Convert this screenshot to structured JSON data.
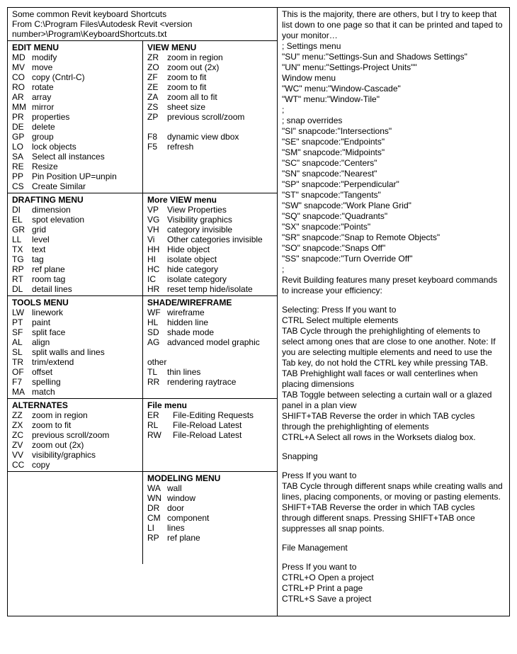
{
  "top_note": {
    "l1": "Some common Revit keyboard Shortcuts",
    "l2": "From  C:\\Program Files\\Autodesk Revit <version number>\\Program\\KeyboardShortcuts.txt"
  },
  "right_intro": "This is the majority, there are others, but I try to keep that list down to one page so that it can be printed and taped to your monitor…",
  "settings_menu_title": "; Settings menu",
  "settings_menu": [
    "\"SU\"  menu:\"Settings-Sun and Shadows Settings\"",
    "\"UN\"  menu:\"Settings-Project Units\"\""
  ],
  "window_menu_title": "Window menu",
  "window_menu": [
    "\"WC\"  menu:\"Window-Cascade\"",
    "\"WT\"  menu:\"Window-Tile\""
  ],
  "snap_title": "; snap overrides",
  "snap_overrides": [
    "\"SI\"    snapcode:\"Intersections\"",
    "\"SE\"   snapcode:\"Endpoints\"",
    "\"SM\"  snapcode:\"Midpoints\"",
    "\"SC\"  snapcode:\"Centers\"",
    "\"SN\"  snapcode:\"Nearest\"",
    "\"SP\"  snapcode:\"Perpendicular\"",
    "\"ST\"   snapcode:\"Tangents\"",
    "\"SW\"  snapcode:\"Work Plane Grid\"",
    "\"SQ\"  snapcode:\"Quadrants\"",
    "\"SX\"   snapcode:\"Points\"",
    "\"SR\"  snapcode:\"Snap to Remote Objects\"",
    "\"SO\"  snapcode:\"Snaps Off\"",
    "\"SS\"  snapcode:\"Turn Override Off\""
  ],
  "tips_intro": "Revit Building features many preset keyboard commands to increase your efficiency:",
  "selecting_title": "Selecting: Press If you want to",
  "selecting": [
    "CTRL Select multiple elements",
    "TAB Cycle through the prehighlighting of elements to select among ones that are close to one another. Note: If you are selecting multiple elements and need to use the Tab key, do not hold the CTRL key while pressing TAB.",
    "TAB Prehighlight wall faces or wall centerlines when placing dimensions",
    "TAB Toggle between selecting a curtain wall or a glazed panel in a plan view",
    "SHIFT+TAB Reverse the order in which TAB cycles through the prehighlighting of elements",
    "CTRL+A Select all rows in the Worksets dialog box."
  ],
  "snapping_title": "Snapping",
  "snapping_press": "Press If you want to",
  "snapping": [
    "TAB Cycle through different snaps while creating walls and lines, placing components, or moving or pasting elements.",
    "SHIFT+TAB Reverse the order in which TAB cycles through different snaps. Pressing SHIFT+TAB once suppresses all snap points."
  ],
  "file_title": "File Management",
  "file_press": "Press If you want to",
  "file_ops": [
    "CTRL+O Open a project",
    "CTRL+P Print a page",
    "CTRL+S Save a project"
  ],
  "menus": {
    "edit": {
      "title": "EDIT MENU",
      "items": [
        {
          "c": "MD",
          "t": "modify"
        },
        {
          "c": "MV",
          "t": "move"
        },
        {
          "c": "CO",
          "t": "copy (Cntrl-C)"
        },
        {
          "c": "RO",
          "t": "rotate"
        },
        {
          "c": "AR",
          "t": "array"
        },
        {
          "c": "MM",
          "t": "mirror"
        },
        {
          "c": "PR",
          "t": "properties"
        },
        {
          "c": "DE",
          "t": "delete"
        },
        {
          "c": "GP",
          "t": "group"
        },
        {
          "c": "LO",
          "t": "lock objects"
        },
        {
          "c": "SA",
          "t": "Select all instances"
        },
        {
          "c": "RE",
          "t": "Resize"
        },
        {
          "c": "PP",
          "t": "Pin Position UP=unpin"
        },
        {
          "c": "CS",
          "t": "Create Similar"
        }
      ]
    },
    "view": {
      "title": "VIEW MENU",
      "items": [
        {
          "c": "ZR",
          "t": "zoom in region"
        },
        {
          "c": "ZO",
          "t": "zoom out (2x)"
        },
        {
          "c": "ZF",
          "t": "zoom to fit"
        },
        {
          "c": "ZE",
          "t": "zoom to fit"
        },
        {
          "c": "ZA",
          "t": "zoom all to fit"
        },
        {
          "c": "ZS",
          "t": "sheet size"
        },
        {
          "c": "ZP",
          "t": "previous scroll/zoom"
        },
        {
          "c": "",
          "t": ""
        },
        {
          "c": "F8",
          "t": "dynamic view dbox"
        },
        {
          "c": "F5",
          "t": "refresh"
        }
      ]
    },
    "drafting": {
      "title": "DRAFTING MENU",
      "items": [
        {
          "c": "DI",
          "t": "dimension"
        },
        {
          "c": "EL",
          "t": "spot elevation"
        },
        {
          "c": "GR",
          "t": "grid"
        },
        {
          "c": "LL",
          "t": "level"
        },
        {
          "c": "TX",
          "t": "text"
        },
        {
          "c": "TG",
          "t": "tag"
        },
        {
          "c": "RP",
          "t": "ref plane"
        },
        {
          "c": "RT",
          "t": "room tag"
        },
        {
          "c": "DL",
          "t": "detail lines"
        }
      ]
    },
    "moreview": {
      "title": "More VIEW menu",
      "items": [
        {
          "c": "VP",
          "t": "View Properties"
        },
        {
          "c": "VG",
          "t": "Visibility graphics"
        },
        {
          "c": "VH",
          "t": "category invisible"
        },
        {
          "c": "Vi",
          "t": "Other categories invisible"
        },
        {
          "c": "HH",
          "t": "Hide object"
        },
        {
          "c": "HI",
          "t": "isolate object"
        },
        {
          "c": "HC",
          "t": "hide category"
        },
        {
          "c": "IC",
          "t": "isolate category"
        },
        {
          "c": "HR",
          "t": "reset temp hide/isolate"
        }
      ]
    },
    "tools": {
      "title": "TOOLS MENU",
      "items": [
        {
          "c": "LW",
          "t": "linework"
        },
        {
          "c": "PT",
          "t": "paint"
        },
        {
          "c": "SF",
          "t": "split face"
        },
        {
          "c": "AL",
          "t": "align"
        },
        {
          "c": "SL",
          "t": "split walls and lines"
        },
        {
          "c": "TR",
          "t": "trim/extend"
        },
        {
          "c": "OF",
          "t": "offset"
        },
        {
          "c": "F7",
          "t": "spelling"
        },
        {
          "c": "MA",
          "t": "match"
        }
      ]
    },
    "shade": {
      "title": "SHADE/WIREFRAME",
      "items": [
        {
          "c": "WF",
          "t": "wireframe"
        },
        {
          "c": "HL",
          "t": "hidden line"
        },
        {
          "c": "SD",
          "t": "shade mode"
        },
        {
          "c": "AG",
          "t": "advanced model graphic"
        },
        {
          "c": "",
          "t": ""
        },
        {
          "c": "other",
          "t": ""
        },
        {
          "c": "TL",
          "t": "thin lines"
        },
        {
          "c": "RR",
          "t": "rendering raytrace"
        }
      ]
    },
    "alternates": {
      "title": "ALTERNATES",
      "items": [
        {
          "c": "ZZ",
          "t": "zoom in region"
        },
        {
          "c": "ZX",
          "t": "zoom to fit"
        },
        {
          "c": "ZC",
          "t": "previous scroll/zoom"
        },
        {
          "c": "ZV",
          "t": "zoom out (2x)"
        },
        {
          "c": "VV",
          "t": "visibility/graphics"
        },
        {
          "c": "CC",
          "t": "copy"
        }
      ]
    },
    "file": {
      "title": "File menu",
      "items": [
        {
          "c": "ER",
          "t": "File-Editing Requests"
        },
        {
          "c": "RL",
          "t": "File-Reload Latest"
        },
        {
          "c": "RW",
          "t": "File-Reload Latest"
        }
      ]
    },
    "modeling": {
      "title": "MODELING MENU",
      "items": [
        {
          "c": "WA",
          "t": "wall"
        },
        {
          "c": "WN",
          "t": "window"
        },
        {
          "c": "DR",
          "t": "door"
        },
        {
          "c": "CM",
          "t": "component"
        },
        {
          "c": "LI",
          "t": "lines"
        },
        {
          "c": "RP",
          "t": "ref plane"
        }
      ]
    }
  }
}
